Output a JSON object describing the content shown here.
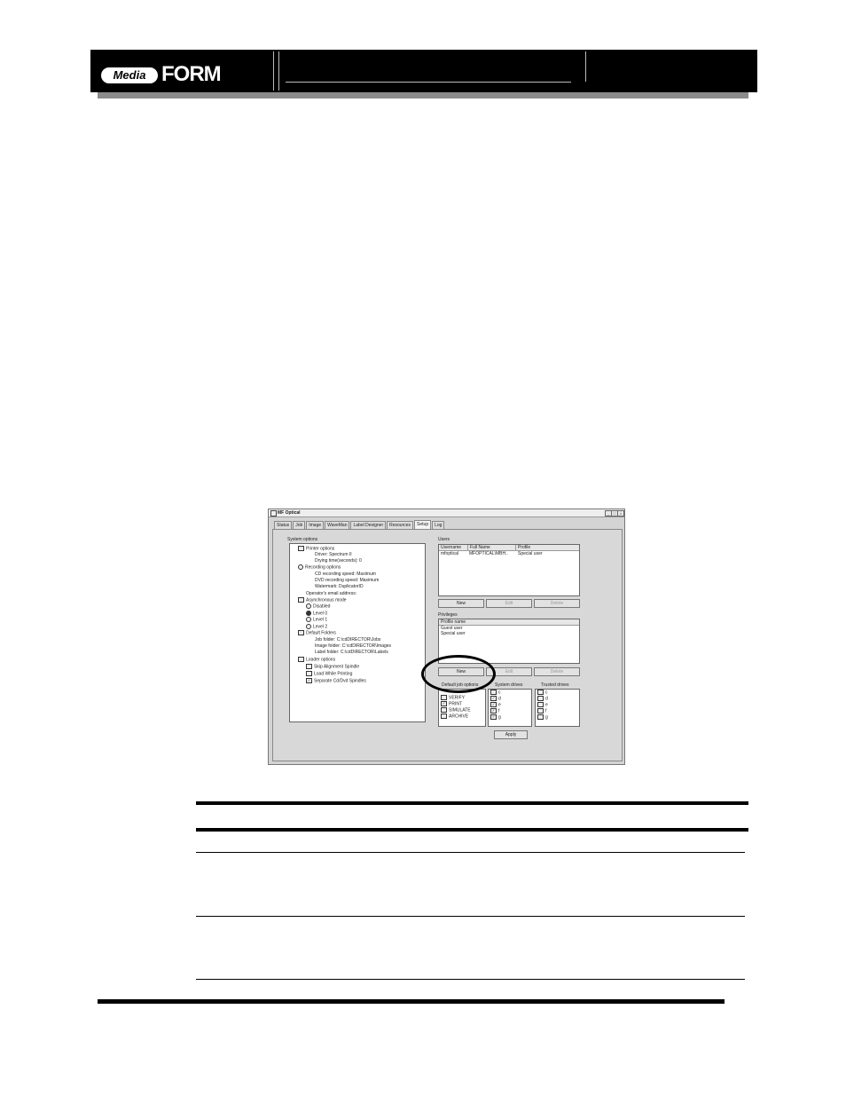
{
  "header": {
    "logo": {
      "media": "Media",
      "form": "FORM"
    }
  },
  "window": {
    "title": "MF Optical",
    "title_buttons": {
      "minimize": "_",
      "maximize": "□",
      "close": "×"
    },
    "tabs": [
      {
        "label": "Status",
        "active": false
      },
      {
        "label": "Job",
        "active": false
      },
      {
        "label": "Image",
        "active": false
      },
      {
        "label": "WaveMan",
        "active": false
      },
      {
        "label": "Label Designer",
        "active": false
      },
      {
        "label": "Resources",
        "active": false
      },
      {
        "label": "Setup",
        "active": true
      },
      {
        "label": "Log",
        "active": false
      }
    ],
    "system_options": {
      "label": "System options",
      "tree": [
        "Printer options",
        "Driver: Spectrum II",
        "Drying time(seconds): 0",
        "Recording options",
        "CD recording speed: Maximum",
        "DVD recording speed: Maximum",
        "Watermark: DuplicatorID",
        "Operator's email address:",
        "Asynchronous mode",
        "Disabled",
        "Level 0",
        "Level 1",
        "Level 2",
        "Default Folders",
        "Job folder: C:\\cdDIRECTOR\\Jobs",
        "Image folder: C:\\cdDIRECTOR\\Images",
        "Label folder: C:\\cdDIRECTOR\\Labels",
        "Loader options",
        "Skip Alignment Spindle",
        "Load While Printing",
        "Separate Cd/Dvd Spindles"
      ]
    },
    "users": {
      "label": "Users",
      "columns": [
        "Username",
        "Full Name",
        "Profile"
      ],
      "rows": [
        [
          "mfoptical",
          "MFOPTICAL\\MBH..",
          "Special user"
        ]
      ],
      "buttons": {
        "new": "New",
        "edit": "Edit",
        "delete": "Delete"
      }
    },
    "privileges": {
      "label": "Privileges",
      "header": "Profile name",
      "rows": [
        "Guest user",
        "Special user"
      ],
      "buttons": {
        "new": "New",
        "edit": "Edit",
        "delete": "Delete"
      }
    },
    "default_job_options": {
      "label": "Default job options",
      "items": [
        "VERIFY",
        "PRINT",
        "SIMULATE",
        "ARCHIVE"
      ],
      "checked": [
        false,
        true,
        false,
        false
      ]
    },
    "system_drives": {
      "label": "System drives",
      "items": [
        "c",
        "d",
        "e",
        "f",
        "g"
      ],
      "checked": [
        false,
        true,
        true,
        true,
        true
      ]
    },
    "trusted_drives": {
      "label": "Trusted drives",
      "items": [
        "c",
        "d",
        "e",
        "f",
        "g"
      ],
      "checked": [
        false,
        false,
        false,
        false,
        false
      ]
    },
    "apply_label": "Apply"
  }
}
